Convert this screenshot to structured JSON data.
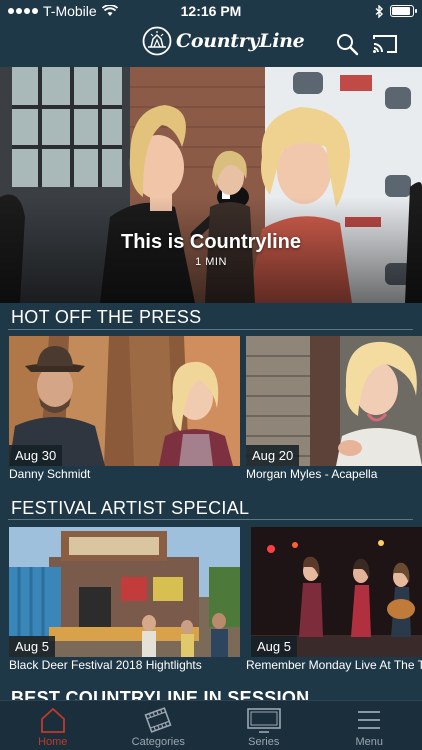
{
  "status_bar": {
    "carrier": "T-Mobile",
    "time": "12:16 PM",
    "battery_level": 0.9
  },
  "header": {
    "brand": "CountryLine",
    "icons": [
      "search-icon",
      "cast-icon"
    ]
  },
  "hero": {
    "title": "This is Countryline",
    "duration": "1 MIN"
  },
  "sections": [
    {
      "title": "HOT OFF THE PRESS",
      "items": [
        {
          "date": "Aug 30",
          "caption": "Danny Schmidt"
        },
        {
          "date": "Aug 20",
          "caption": "Morgan Myles - Acapella"
        }
      ]
    },
    {
      "title": "FESTIVAL ARTIST SPECIAL",
      "items": [
        {
          "date": "Aug 5",
          "caption": "Black Deer Festival 2018 Hightlights"
        },
        {
          "date": "Aug 5",
          "caption": "Remember Monday Live At The Troubadour"
        }
      ]
    },
    {
      "title": "BEST COUNTRYLINE IN SESSION"
    }
  ],
  "tabbar": {
    "active": "Home",
    "tabs": [
      {
        "label": "Home",
        "icon": "home-icon"
      },
      {
        "label": "Categories",
        "icon": "film-icon"
      },
      {
        "label": "Series",
        "icon": "tv-icon"
      },
      {
        "label": "Menu",
        "icon": "menu-icon"
      }
    ]
  },
  "colors": {
    "background": "#1f3848",
    "accent_red": "#c0392b",
    "tab_inactive": "#9aa7b0"
  }
}
